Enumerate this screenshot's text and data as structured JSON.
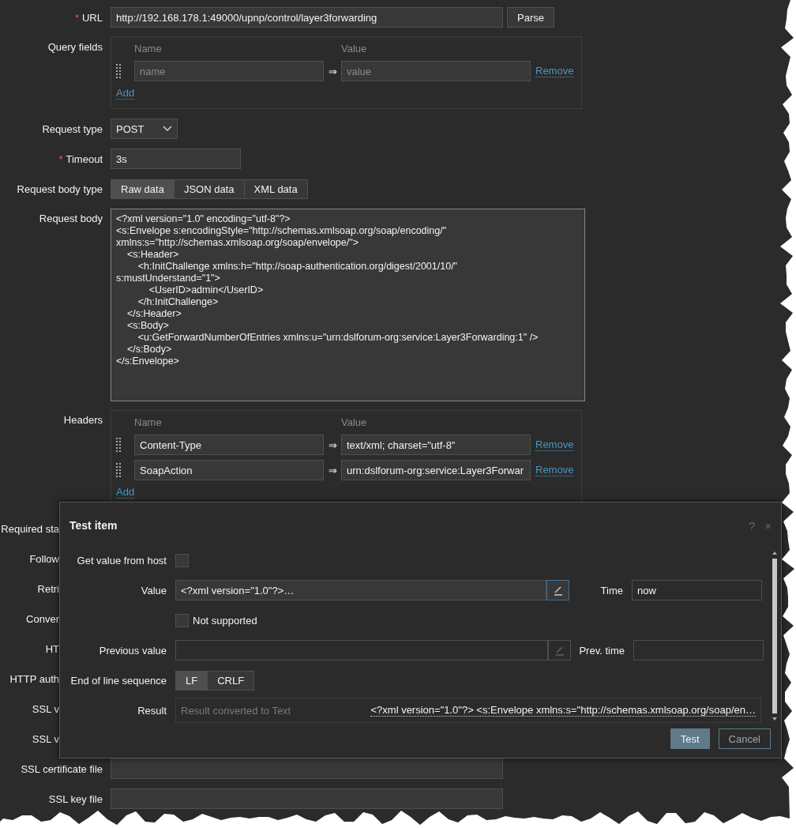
{
  "url": {
    "label": "URL",
    "required_mark": "*",
    "value": "http://192.168.178.1:49000/upnp/control/layer3forwarding",
    "button": "Parse"
  },
  "query_fields": {
    "label": "Query fields",
    "columns": [
      "Name",
      "Value"
    ],
    "rows": [
      {
        "name_placeholder": "name",
        "arrow": "⇒",
        "value_placeholder": "value",
        "remove": "Remove"
      }
    ],
    "add": "Add"
  },
  "request_type": {
    "label": "Request type",
    "value": "POST"
  },
  "timeout": {
    "label": "Timeout",
    "required_mark": "*",
    "value": "3s"
  },
  "request_body_type": {
    "label": "Request body type",
    "options": [
      {
        "label": "Raw data",
        "selected": true
      },
      {
        "label": "JSON data",
        "selected": false
      },
      {
        "label": "XML data",
        "selected": false
      }
    ]
  },
  "request_body": {
    "label": "Request body",
    "value": "<?xml version=\"1.0\" encoding=\"utf-8\"?>\n<s:Envelope s:encodingStyle=\"http://schemas.xmlsoap.org/soap/encoding/\"\nxmlns:s=\"http://schemas.xmlsoap.org/soap/envelope/\">\n    <s:Header>\n        <h:InitChallenge xmlns:h=\"http://soap-authentication.org/digest/2001/10/\"\ns:mustUnderstand=\"1\">\n            <UserID>admin</UserID>\n        </h:InitChallenge>\n    </s:Header>\n    <s:Body>\n        <u:GetForwardNumberOfEntries xmlns:u=\"urn:dslforum-org:service:Layer3Forwarding:1\" />\n    </s:Body>\n</s:Envelope>"
  },
  "headers": {
    "label": "Headers",
    "columns": [
      "Name",
      "Value"
    ],
    "rows": [
      {
        "name": "Content-Type",
        "arrow": "⇒",
        "value": "text/xml; charset=\"utf-8\"",
        "remove": "Remove"
      },
      {
        "name": "SoapAction",
        "arrow": "⇒",
        "value": "urn:dslforum-org:service:Layer3Forwar",
        "remove": "Remove"
      }
    ],
    "add": "Add"
  },
  "covered_labels": [
    "Required sta",
    "Follow",
    "Retri",
    "Conver",
    "HT",
    "HTTP auth",
    "SSL v",
    "SSL v"
  ],
  "file_fields": [
    {
      "label": "SSL certificate file"
    },
    {
      "label": "SSL key file"
    }
  ],
  "dialog": {
    "title": "Test item",
    "help": "?",
    "close": "×",
    "get_value_from_host": {
      "label": "Get value from host",
      "checked": false
    },
    "value": {
      "label": "Value",
      "value": "<?xml version=\"1.0\"?>…"
    },
    "time": {
      "label": "Time",
      "value": "now"
    },
    "not_supported": {
      "label": "Not supported",
      "checked": false
    },
    "previous_value": {
      "label": "Previous value"
    },
    "prev_time": {
      "label": "Prev. time"
    },
    "end_of_line": {
      "label": "End of line sequence",
      "options": [
        {
          "label": "LF",
          "selected": true
        },
        {
          "label": "CRLF",
          "selected": false
        }
      ]
    },
    "result": {
      "label": "Result",
      "placeholder": "Result converted to Text",
      "value": "<?xml version=\"1.0\"?> <s:Envelope xmlns:s=\"http://schemas.xmlsoap.org/soap/en…"
    },
    "buttons": [
      {
        "label": "Test",
        "kind": "primary"
      },
      {
        "label": "Cancel",
        "kind": "secondary"
      }
    ]
  }
}
